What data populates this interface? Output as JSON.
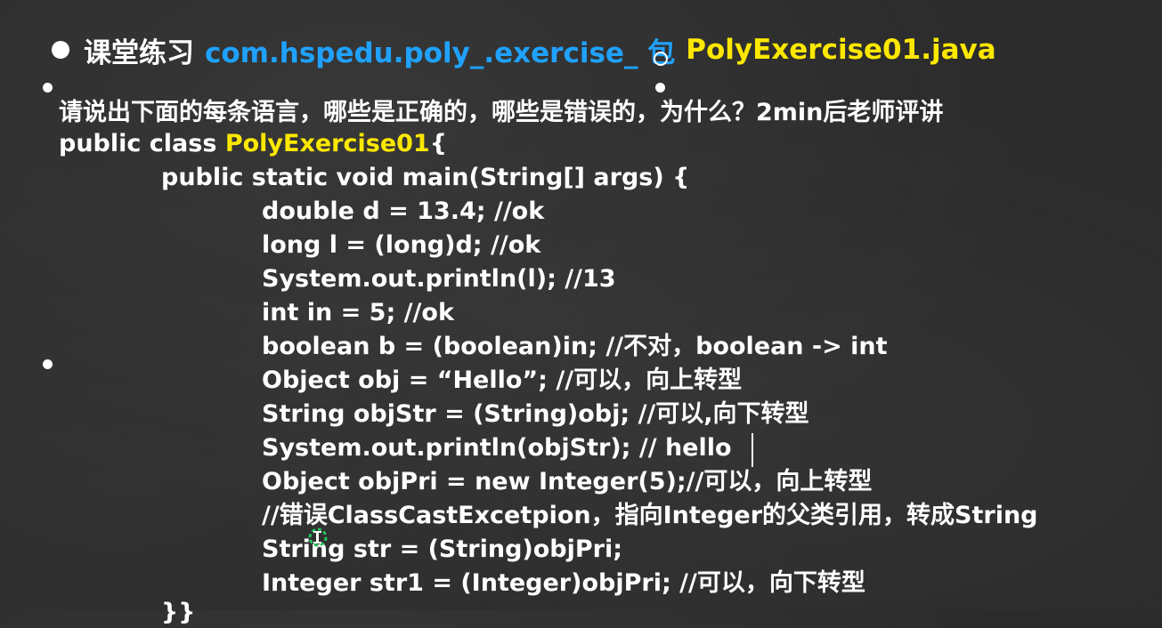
{
  "title": {
    "lead": "课堂练习",
    "package": "com.hspedu.poly_.exercise_ 包",
    "file": "PolyExercise01.java"
  },
  "colors": {
    "background": "#2b2b2b",
    "text": "#ffffff",
    "blue": "#1fa2ff",
    "yellow": "#ffe800"
  },
  "icons": [
    "bullet-dot",
    "cursor-ring",
    "text-caret",
    "mouse-pointer-icon"
  ],
  "question": "请说出下面的每条语言，哪些是正确的，哪些是错误的，为什么？2min后老师评讲",
  "code": {
    "class_prefix": "public class ",
    "class_name": "PolyExercise01",
    "class_suffix": "{",
    "main": "public static void main(String[] args) {",
    "lines": [
      "double d = 13.4; //ok",
      "long l = (long)d; //ok",
      "System.out.println(l);   //13",
      "int in = 5; //ok",
      "boolean b = (boolean)in; //不对，boolean -> int",
      "Object obj = “Hello”; //可以，向上转型",
      "String objStr = (String)obj;  //可以,向下转型",
      "System.out.println(objStr); // hello",
      "Object objPri = new Integer(5);//可以，向上转型",
      "//错误ClassCastExcetpion，指向Integer的父类引用，转成String",
      "String str = (String)objPri;",
      "Integer str1 = (Integer)objPri; //可以，向下转型"
    ],
    "closing": "}}"
  }
}
